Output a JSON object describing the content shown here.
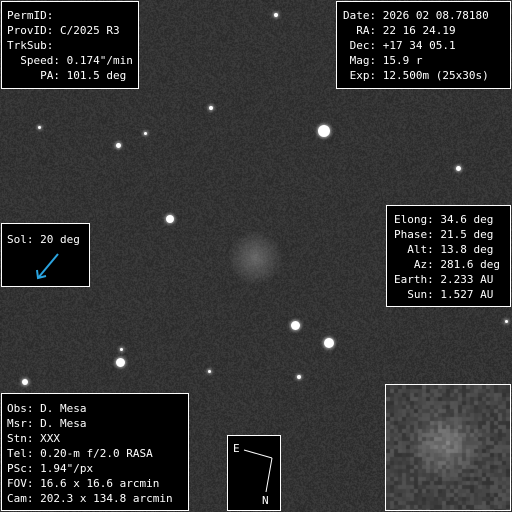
{
  "top_left": {
    "lines": [
      "PermID:",
      "ProvID: C/2025 R3",
      "TrkSub:",
      "  Speed: 0.174\"/min",
      "     PA: 101.5 deg"
    ]
  },
  "top_right": {
    "lines": [
      "Date: 2026 02 08.78180",
      "  RA: 22 16 24.19",
      " Dec: +17 34 05.1",
      " Mag: 15.9 r",
      " Exp: 12.500m (25x30s)"
    ]
  },
  "sol": {
    "label": "Sol: 20 deg",
    "arrow_color": "#2aa4e0",
    "icon": "sun-direction-arrow-icon"
  },
  "geometry_panel": {
    "lines": [
      "Elong: 34.6 deg",
      "Phase: 21.5 deg",
      "  Alt: 13.8 deg",
      "   Az: 281.6 deg",
      "Earth: 2.233 AU",
      "  Sun: 1.527 AU"
    ]
  },
  "observer_panel": {
    "lines": [
      "Obs: D. Mesa",
      "Msr: D. Mesa",
      "Stn: XXX",
      "Tel: 0.20-m f/2.0 RASA",
      "PSc: 1.94\"/px",
      "FOV: 16.6 x 16.6 arcmin",
      "Cam: 202.3 x 134.8 arcmin"
    ]
  },
  "compass": {
    "east_label": "E",
    "north_label": "N",
    "icon": "compass-rose-icon"
  },
  "inset": {
    "icon": "comet-zoom-thumbnail"
  }
}
